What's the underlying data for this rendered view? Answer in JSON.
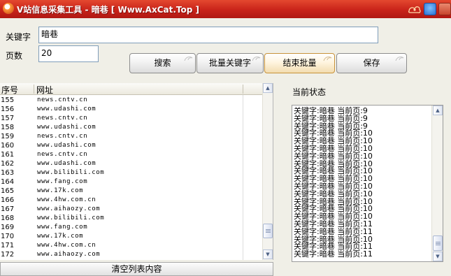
{
  "window": {
    "title": "V站信息采集工具 - 暗巷 [ Www.AxCat.Top ]"
  },
  "form": {
    "keyword_label": "关键字",
    "keyword_value": "暗巷",
    "pages_label": "页数",
    "pages_value": "20"
  },
  "buttons": {
    "search": "搜索",
    "batch_keyword": "批量关键字",
    "end_batch": "结束批量",
    "save": "保存"
  },
  "list": {
    "headers": {
      "index": "序号",
      "url": "网址"
    },
    "rows": [
      {
        "index": "155",
        "url": "news.cntv.cn"
      },
      {
        "index": "156",
        "url": "www.udashi.com"
      },
      {
        "index": "157",
        "url": "news.cntv.cn"
      },
      {
        "index": "158",
        "url": "www.udashi.com"
      },
      {
        "index": "159",
        "url": "news.cntv.cn"
      },
      {
        "index": "160",
        "url": "www.udashi.com"
      },
      {
        "index": "161",
        "url": "news.cntv.cn"
      },
      {
        "index": "162",
        "url": "www.udashi.com"
      },
      {
        "index": "163",
        "url": "www.bilibili.com"
      },
      {
        "index": "164",
        "url": "www.fang.com"
      },
      {
        "index": "165",
        "url": "www.17k.com"
      },
      {
        "index": "166",
        "url": "www.4hw.com.cn"
      },
      {
        "index": "167",
        "url": "www.aihaozy.com"
      },
      {
        "index": "168",
        "url": "www.bilibili.com"
      },
      {
        "index": "169",
        "url": "www.fang.com"
      },
      {
        "index": "170",
        "url": "www.17k.com"
      },
      {
        "index": "171",
        "url": "www.4hw.com.cn"
      },
      {
        "index": "172",
        "url": "www.aihaozy.com"
      }
    ]
  },
  "clear_button": "清空列表内容",
  "status": {
    "label": "当前状态",
    "lines": [
      "关键字:暗巷  当前页:9",
      "关键字:暗巷  当前页:9",
      "关键字:暗巷  当前页:9",
      "关键字:暗巷  当前页:10",
      "关键字:暗巷  当前页:10",
      "关键字:暗巷  当前页:10",
      "关键字:暗巷  当前页:10",
      "关键字:暗巷  当前页:10",
      "关键字:暗巷  当前页:10",
      "关键字:暗巷  当前页:10",
      "关键字:暗巷  当前页:10",
      "关键字:暗巷  当前页:10",
      "关键字:暗巷  当前页:10",
      "关键字:暗巷  当前页:10",
      "关键字:暗巷  当前页:10",
      "关键字:暗巷  当前页:11",
      "关键字:暗巷  当前页:11",
      "关键字:暗巷  当前页:10",
      "关键字:暗巷  当前页:11",
      "关键字:暗巷  当前页:11"
    ]
  },
  "colors": {
    "title_bar": "#c8231a",
    "window_bg": "#f0efe7",
    "active_button": "#f2dcb0"
  },
  "icons": {
    "app": "app-icon",
    "ornament": "cloud-ornament-icon",
    "skin": "skin-icon",
    "minimize": "minimize-icon"
  }
}
